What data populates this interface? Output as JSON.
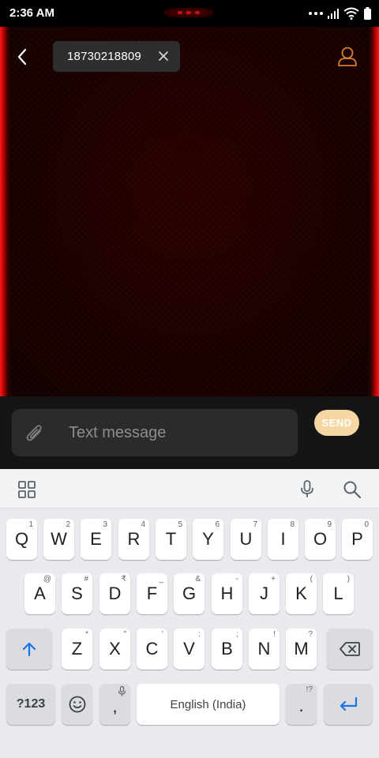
{
  "status_bar": {
    "time": "2:36 AM",
    "icons": [
      "more-dots-icon",
      "signal-icon",
      "wifi-icon",
      "battery-icon"
    ]
  },
  "header": {
    "back_icon": "chevron-left-icon",
    "recipient": "18730218809",
    "remove_icon": "close-icon",
    "contact_icon": "person-outline-icon",
    "accent_color": "#e07a2e"
  },
  "composer": {
    "attach_icon": "paperclip-icon",
    "placeholder": "Text message",
    "send_label": "SEND",
    "send_color": "#f6d7a4"
  },
  "keyboard_toolbar": {
    "icons": [
      "grid-icon",
      "mic-icon",
      "search-icon"
    ]
  },
  "keyboard": {
    "row1": [
      {
        "label": "Q",
        "hint": "1"
      },
      {
        "label": "W",
        "hint": "2"
      },
      {
        "label": "E",
        "hint": "3"
      },
      {
        "label": "R",
        "hint": "4"
      },
      {
        "label": "T",
        "hint": "5"
      },
      {
        "label": "Y",
        "hint": "6"
      },
      {
        "label": "U",
        "hint": "7"
      },
      {
        "label": "I",
        "hint": "8"
      },
      {
        "label": "O",
        "hint": "9"
      },
      {
        "label": "P",
        "hint": "0"
      }
    ],
    "row2": [
      {
        "label": "A",
        "hint": "@"
      },
      {
        "label": "S",
        "hint": "#"
      },
      {
        "label": "D",
        "hint": "₹"
      },
      {
        "label": "F",
        "hint": "_"
      },
      {
        "label": "G",
        "hint": "&"
      },
      {
        "label": "H",
        "hint": "-"
      },
      {
        "label": "J",
        "hint": "+"
      },
      {
        "label": "K",
        "hint": "("
      },
      {
        "label": "L",
        "hint": ")"
      }
    ],
    "row3": [
      {
        "label": "Z",
        "hint": "*"
      },
      {
        "label": "X",
        "hint": "\""
      },
      {
        "label": "C",
        "hint": "'"
      },
      {
        "label": "V",
        "hint": ":"
      },
      {
        "label": "B",
        "hint": ";"
      },
      {
        "label": "N",
        "hint": "!"
      },
      {
        "label": "M",
        "hint": "?"
      }
    ],
    "shift_icon": "shift-arrow-icon",
    "backspace_icon": "backspace-icon",
    "symbols_label": "?123",
    "emoji_icon": "emoji-icon",
    "comma_label": ",",
    "space_label": "English (India)",
    "period_label": ".",
    "period_hint": "!?",
    "enter_icon": "enter-arrow-icon",
    "accent_color": "#1a73e8"
  }
}
